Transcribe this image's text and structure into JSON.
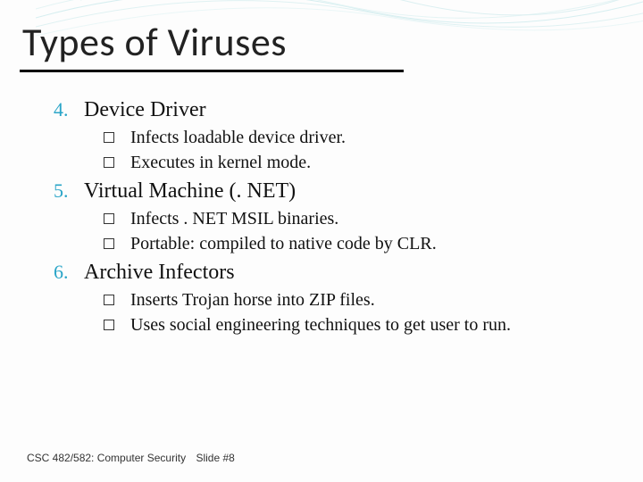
{
  "title": "Types of Viruses",
  "items": [
    {
      "num": "4.",
      "label": "Device Driver",
      "subs": [
        "Infects loadable device driver.",
        "Executes in kernel mode."
      ]
    },
    {
      "num": "5.",
      "label": "Virtual Machine (. NET)",
      "subs": [
        "Infects . NET MSIL binaries.",
        "Portable: compiled to native code by CLR."
      ]
    },
    {
      "num": "6.",
      "label": "Archive Infectors",
      "subs": [
        "Inserts Trojan horse into ZIP files.",
        "Uses social engineering techniques to get user to run."
      ]
    }
  ],
  "footer": {
    "course": "CSC 482/582: Computer Security",
    "slide": "Slide #8"
  }
}
